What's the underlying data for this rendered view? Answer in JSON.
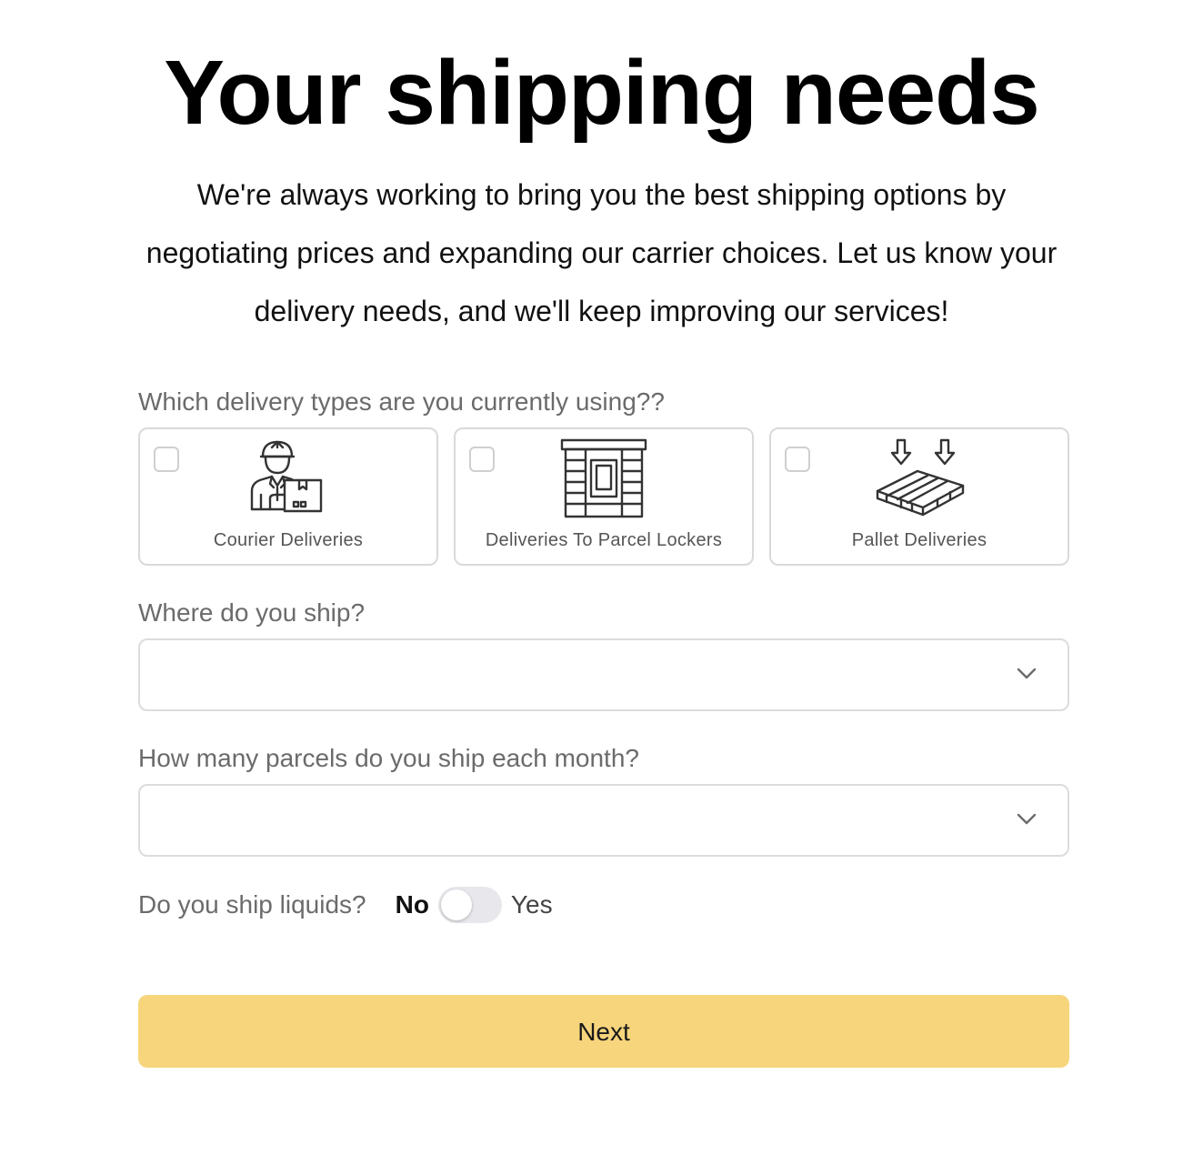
{
  "header": {
    "title": "Your shipping needs",
    "intro": "We're always working to bring you the best shipping options by negotiating prices and expanding our carrier choices. Let us know your delivery needs, and we'll keep improving our services!"
  },
  "delivery_types": {
    "label": "Which delivery types are you currently using??",
    "options": [
      {
        "label": "Courier Deliveries",
        "icon": "courier-icon",
        "checked": false
      },
      {
        "label": "Deliveries To Parcel Lockers",
        "icon": "parcel-locker-icon",
        "checked": false
      },
      {
        "label": "Pallet Deliveries",
        "icon": "pallet-icon",
        "checked": false
      }
    ]
  },
  "ship_where": {
    "label": "Where do you ship?",
    "value": ""
  },
  "parcels_per_month": {
    "label": "How many parcels do you ship each month?",
    "value": ""
  },
  "liquids": {
    "label": "Do you ship liquids?",
    "no_label": "No",
    "yes_label": "Yes",
    "value": false
  },
  "actions": {
    "next_label": "Next"
  },
  "colors": {
    "accent": "#f7d57c",
    "border": "#d9d9d9",
    "label_text": "#6b6b6b"
  }
}
